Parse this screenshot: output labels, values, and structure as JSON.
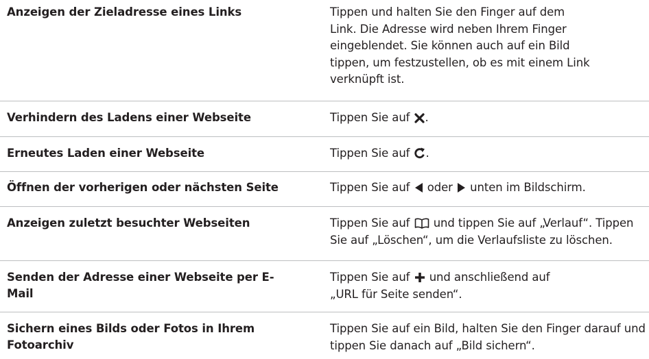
{
  "rows": [
    {
      "action": "Anzeigen der Zieladresse eines Links",
      "instruction": "Tippen und halten Sie den Finger auf dem Link. Die Adresse wird neben Ihrem Finger eingeblendet. Sie können auch auf ein Bild tippen, um festzustellen, ob es mit einem Link verknüpft ist."
    },
    {
      "action": "Verhindern des Ladens einer Webseite",
      "instruction_pre": "Tippen Sie auf",
      "icon": "stop-x-icon",
      "instruction_post": "."
    },
    {
      "action": "Erneutes Laden einer Webseite",
      "instruction_pre": "Tippen Sie auf",
      "icon": "reload-icon",
      "instruction_post": "."
    },
    {
      "action": "Öffnen der vorherigen oder nächsten Seite",
      "instruction_pre": "Tippen Sie auf",
      "icon_1": "back-arrow-icon",
      "instruction_mid": "oder",
      "icon_2": "forward-arrow-icon",
      "instruction_post": "unten im Bildschirm."
    },
    {
      "action": "Anzeigen zuletzt besuchter Webseiten",
      "instruction_pre": "Tippen Sie auf",
      "icon": "bookmarks-icon",
      "instruction_post": "und tippen Sie auf „Verlauf“. Tippen Sie auf „Löschen“, um die Verlaufsliste zu löschen."
    },
    {
      "action": "Senden der Adresse einer Webseite per E-Mail",
      "instruction_pre": "Tippen Sie auf",
      "icon": "plus-icon",
      "instruction_post": "und anschließend auf „URL für Seite senden“."
    },
    {
      "action": "Sichern eines Bilds oder Fotos in Ihrem Fotoarchiv",
      "instruction": "Tippen Sie auf ein Bild, halten Sie den Finger darauf und tippen Sie danach auf „Bild sichern“."
    }
  ],
  "colors": {
    "text": "#231f20",
    "divider": "#bcbec0"
  }
}
